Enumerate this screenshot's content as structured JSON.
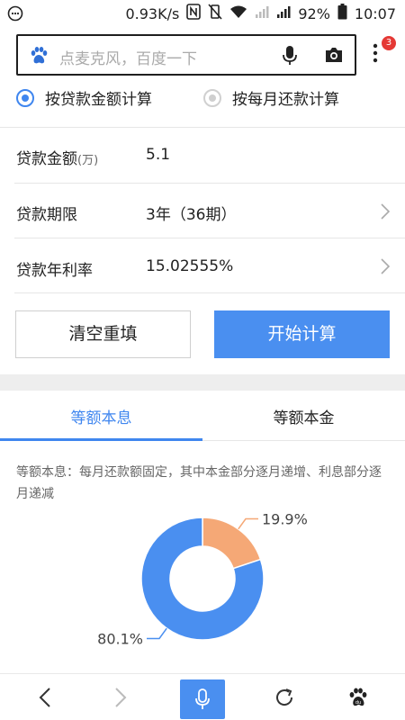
{
  "status_bar": {
    "speed": "0.93K/s",
    "battery": "92%",
    "time": "10:07"
  },
  "search": {
    "placeholder": "点麦克风，百度一下",
    "badge_count": "3"
  },
  "mode": {
    "options": [
      {
        "label": "按贷款金额计算",
        "selected": true
      },
      {
        "label": "按每月还款计算",
        "selected": false
      }
    ]
  },
  "form": {
    "amount_label": "贷款金额",
    "amount_unit": "(万)",
    "amount_value": "5.1",
    "term_label": "贷款期限",
    "term_value": "3年（36期）",
    "rate_label": "贷款年利率",
    "rate_value": "15.02555%"
  },
  "buttons": {
    "clear": "清空重填",
    "start": "开始计算"
  },
  "tabs": {
    "active": "等额本息",
    "inactive": "等额本金"
  },
  "description": "等额本息：每月还款额固定，其中本金部分逐月递增、利息部分逐月递减",
  "colors": {
    "accent": "#4a8ff0",
    "slice_major": "#4a8ff0",
    "slice_minor": "#f5a876"
  },
  "chart_data": {
    "type": "pie",
    "style": "donut",
    "slices": [
      {
        "label": "80.1%",
        "value": 80.1,
        "color": "#4a8ff0"
      },
      {
        "label": "19.9%",
        "value": 19.9,
        "color": "#f5a876"
      }
    ]
  }
}
